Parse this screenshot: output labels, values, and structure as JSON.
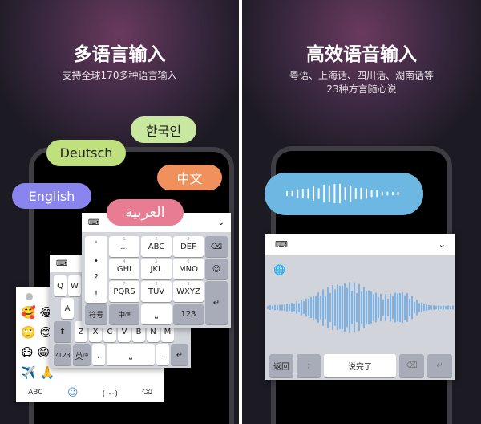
{
  "left": {
    "title": "多语言输入",
    "subtitle": "支持全球170多种语言输入",
    "bubbles": [
      {
        "label": "한국인",
        "color": "#c8e8a0"
      },
      {
        "label": "Deutsch",
        "color": "#bfe07c"
      },
      {
        "label": "中文",
        "color": "#f0905c"
      },
      {
        "label": "English",
        "color": "#8a84ee"
      },
      {
        "label": "العربية",
        "color": "#e87c92"
      }
    ],
    "t9": {
      "punct": [
        "'",
        "•",
        "?",
        "!"
      ],
      "keys": [
        {
          "n": "1",
          "l": "..."
        },
        {
          "n": "2",
          "l": "ABC"
        },
        {
          "n": "3",
          "l": "DEF"
        },
        {
          "n": "4",
          "l": "GHI"
        },
        {
          "n": "5",
          "l": "JKL"
        },
        {
          "n": "6",
          "l": "MNO"
        },
        {
          "n": "7",
          "l": "PQRS"
        },
        {
          "n": "8",
          "l": "TUV"
        },
        {
          "n": "9",
          "l": "WXYZ"
        }
      ],
      "symbol": "符号",
      "zh": "中",
      "zh_sub": "/英",
      "num": "123"
    },
    "qwerty": {
      "row1": [
        "Q",
        "W"
      ],
      "row2": [
        "A",
        "S"
      ],
      "row3": [
        "Z",
        "X",
        "C",
        "V",
        "B",
        "N",
        "M"
      ],
      "num": "?123",
      "en": "英",
      "en_sub": "/中",
      "comma": ",",
      "period": "."
    },
    "emoji": {
      "items": [
        "🥰",
        "😂",
        "🙄",
        "😊",
        "😷",
        "😁",
        "✈️",
        "🙏"
      ],
      "abc": "ABC",
      "kaomoji": "(･-･)"
    }
  },
  "right": {
    "title": "高效语音输入",
    "subtitle_line1": "粤语、上海话、四川话、湖南话等",
    "subtitle_line2": "23种方言随心说",
    "voice": {
      "back": "返回",
      "semicolon": ";",
      "done": "说完了",
      "wave_color": "#5aa3e6",
      "bubble_color": "#6cb8e2"
    }
  }
}
